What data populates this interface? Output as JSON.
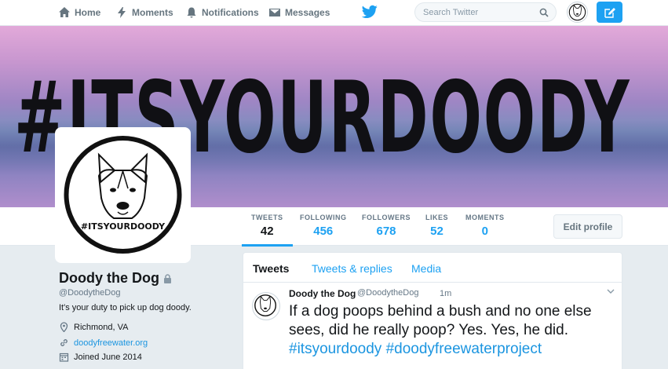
{
  "nav": {
    "home": "Home",
    "moments": "Moments",
    "notifications": "Notifications",
    "messages": "Messages",
    "search_placeholder": "Search Twitter"
  },
  "banner": {
    "text": "#ITSYOURDOODY"
  },
  "avatar": {
    "text": "#ITSYOURDOODY"
  },
  "stats": [
    {
      "label": "TWEETS",
      "value": "42"
    },
    {
      "label": "FOLLOWING",
      "value": "456"
    },
    {
      "label": "FOLLOWERS",
      "value": "678"
    },
    {
      "label": "LIKES",
      "value": "52"
    },
    {
      "label": "MOMENTS",
      "value": "0"
    }
  ],
  "edit_profile": "Edit profile",
  "profile": {
    "name": "Doody the Dog",
    "handle": "@DoodytheDog",
    "bio": "It's your duty to pick up dog doody.",
    "location": "Richmond, VA",
    "url": "doodyfreewater.org",
    "joined": "Joined June 2014"
  },
  "tabs": {
    "tweets": "Tweets",
    "replies": "Tweets & replies",
    "media": "Media"
  },
  "tweet": {
    "name": "Doody the Dog",
    "handle": "@DoodytheDog",
    "time": "1m",
    "text": "If a dog poops behind a bush and no one else sees, did he really poop? Yes. Yes, he did.",
    "hashtags": [
      "#itsyourdoody",
      "#doodyfreewaterproject"
    ]
  },
  "colors": {
    "accent": "#1da1f2",
    "link": "#1b95e0",
    "background": "#e6ecf0"
  },
  "icons": [
    "home-icon",
    "lightning-icon",
    "bell-icon",
    "envelope-icon",
    "twitter-bird-icon",
    "search-icon",
    "compose-icon",
    "lock-icon",
    "location-pin-icon",
    "link-icon",
    "calendar-icon",
    "chevron-down-icon"
  ]
}
